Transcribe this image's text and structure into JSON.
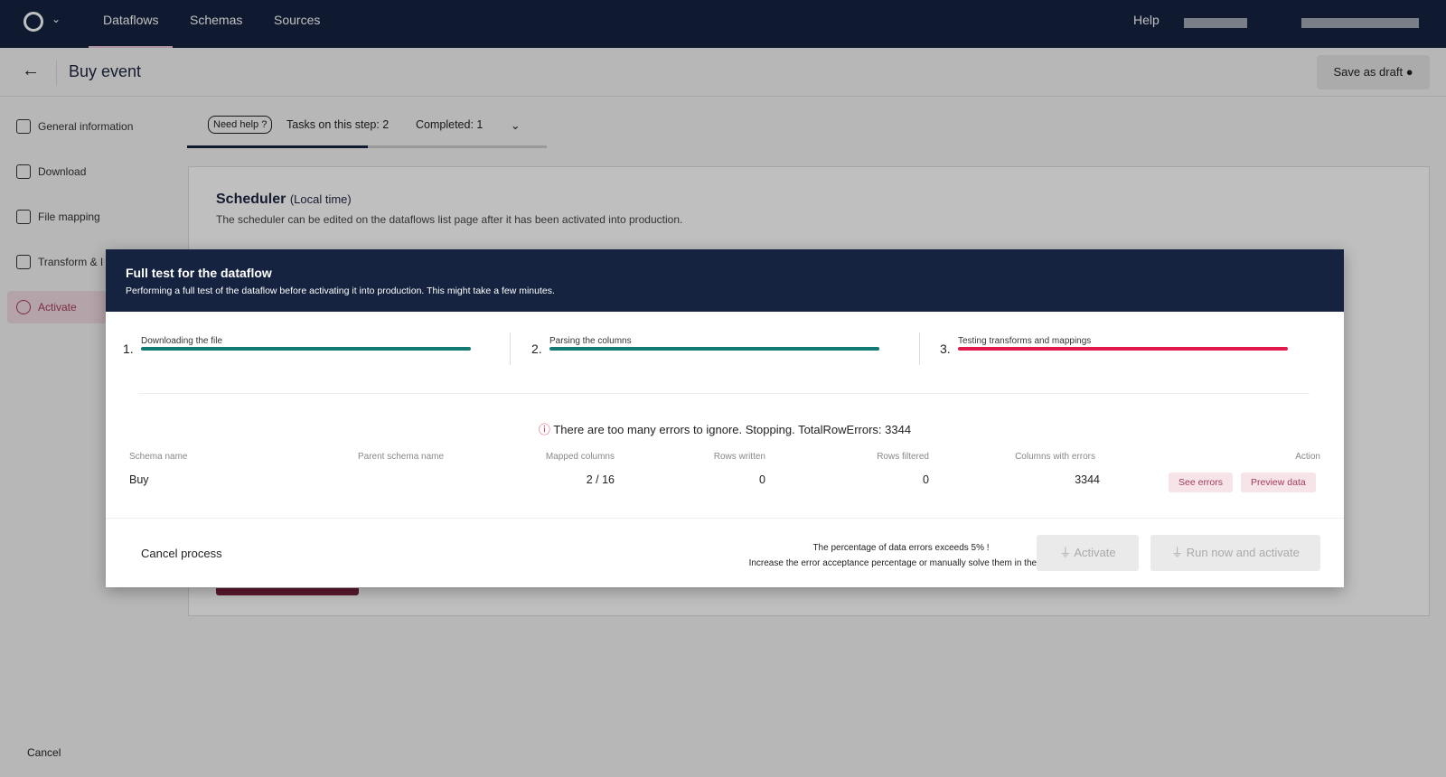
{
  "topbar": {
    "nav": [
      "Dataflows",
      "Schemas",
      "Sources"
    ],
    "active": "Dataflows",
    "help": "Help"
  },
  "header": {
    "title": "Buy event",
    "save_draft": "Save as draft"
  },
  "sidebar": {
    "items": [
      {
        "label": "General information",
        "icon": "gear-icon"
      },
      {
        "label": "Download",
        "icon": "download-icon"
      },
      {
        "label": "File mapping",
        "icon": "file-icon"
      },
      {
        "label": "Transform & I",
        "icon": "table-icon"
      },
      {
        "label": "Activate",
        "icon": "power-icon"
      }
    ],
    "cancel": "Cancel"
  },
  "tasks": {
    "need_help": "Need help ?",
    "tasks": "Tasks on this step: 2",
    "completed": "Completed: 1",
    "progress": 0.5
  },
  "scheduler": {
    "title": "Scheduler",
    "subtitle": "(Local time)",
    "desc": "The scheduler can be edited on the dataflows list page after it has been activated into production."
  },
  "modal": {
    "title": "Full test for the dataflow",
    "subtitle": "Performing a full test of the dataflow before activating it into production. This might take a few minutes.",
    "steps": [
      {
        "num": "1.",
        "label": "Downloading the file",
        "color": "#127a72"
      },
      {
        "num": "2.",
        "label": "Parsing the columns",
        "color": "#127a72"
      },
      {
        "num": "3.",
        "label": "Testing transforms and mappings",
        "color": "#e0194a"
      }
    ],
    "error": "There are too many errors to ignore. Stopping. TotalRowErrors: 3344",
    "columns": [
      "Schema name",
      "Parent schema name",
      "Mapped columns",
      "Rows written",
      "Rows filtered",
      "Columns with errors",
      "Action"
    ],
    "row": {
      "schema": "Buy",
      "parent": "",
      "mapped": "2 / 16",
      "written": "0",
      "filtered": "0",
      "errors": "3344"
    },
    "see_errors": "See errors",
    "preview": "Preview data",
    "cancel": "Cancel process",
    "warn1": "The percentage of data errors exceeds 5% !",
    "warn2": "Increase the error acceptance percentage or manually solve them in the file.",
    "activate": "Activate",
    "run_activate": "Run now and activate"
  }
}
